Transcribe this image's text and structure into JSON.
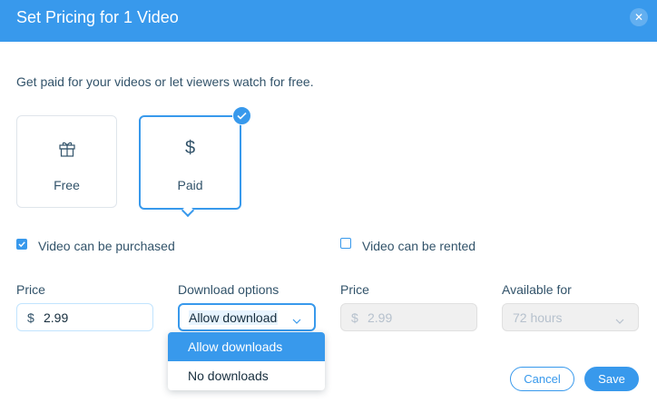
{
  "dialog": {
    "title": "Set Pricing for 1 Video",
    "close_icon": "close-icon"
  },
  "intro_text": "Get paid for your videos or let viewers watch for free.",
  "pricing_type": {
    "selected": "Paid",
    "options": [
      {
        "label": "Free",
        "icon": "gift-icon"
      },
      {
        "label": "Paid",
        "icon": "dollar-icon"
      }
    ]
  },
  "purchase": {
    "checkbox_label": "Video can be purchased",
    "checked": true,
    "price_label": "Price",
    "currency": "$",
    "price_value": "2.99",
    "download_label": "Download options",
    "download_selected": "Allow downloads",
    "download_menu": [
      "Allow downloads",
      "No downloads"
    ]
  },
  "rent": {
    "checkbox_label": "Video can be rented",
    "checked": false,
    "price_label": "Price",
    "currency": "$",
    "price_value": "2.99",
    "available_label": "Available for",
    "available_value": "72 hours"
  },
  "footer": {
    "cancel_label": "Cancel",
    "save_label": "Save"
  },
  "colors": {
    "accent": "#3899ec",
    "text": "#32536a",
    "disabled_bg": "#f0f0f0"
  }
}
